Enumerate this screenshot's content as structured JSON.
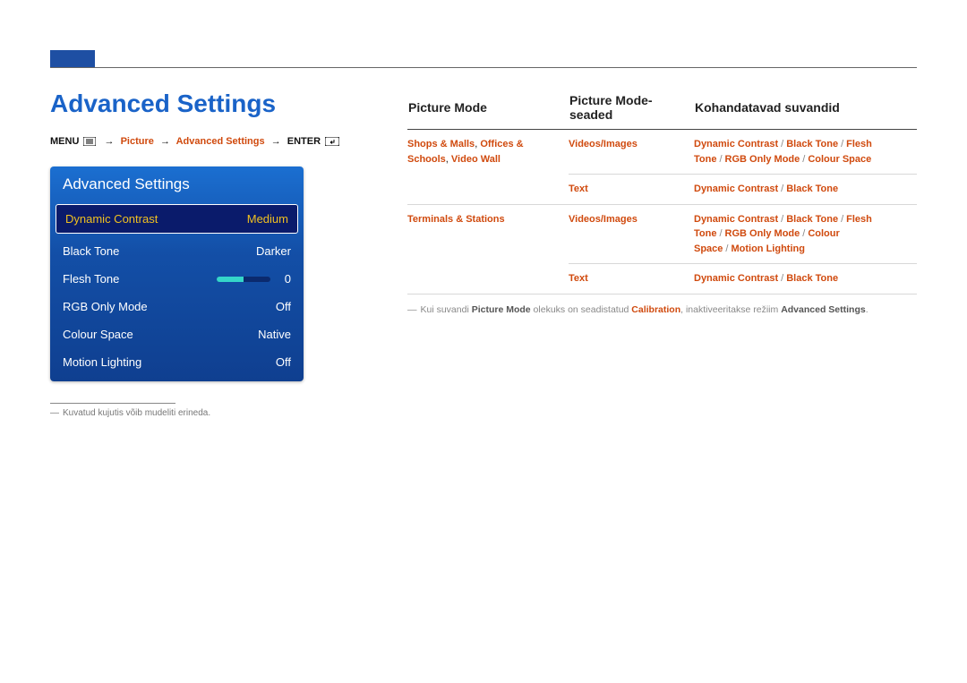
{
  "title": "Advanced Settings",
  "breadcrumb": {
    "menu": "MENU",
    "picture": "Picture",
    "adv": "Advanced Settings",
    "enter": "ENTER"
  },
  "panel": {
    "header": "Advanced Settings",
    "rows": [
      {
        "label": "Dynamic Contrast",
        "value": "Medium",
        "selected": true
      },
      {
        "label": "Black Tone",
        "value": "Darker"
      },
      {
        "label": "Flesh Tone",
        "value": "0",
        "slider": true
      },
      {
        "label": "RGB Only Mode",
        "value": "Off"
      },
      {
        "label": "Colour Space",
        "value": "Native"
      },
      {
        "label": "Motion Lighting",
        "value": "Off"
      }
    ]
  },
  "footnote": "Kuvatud kujutis võib mudeliti erineda.",
  "table": {
    "headers": [
      "Picture Mode",
      "Picture Mode-seaded",
      "Kohandatavad suvandid"
    ],
    "rows": [
      {
        "mode_parts": [
          "Shops & Malls",
          "Offices & Schools",
          "Video Wall"
        ],
        "seaded": "Videos/Images",
        "opts": [
          "Dynamic Contrast",
          "Black Tone",
          "Flesh Tone",
          "RGB Only Mode",
          "Colour Space"
        ]
      },
      {
        "seaded": "Text",
        "opts": [
          "Dynamic Contrast",
          "Black Tone"
        ]
      },
      {
        "mode_parts": [
          "Terminals & Stations"
        ],
        "seaded": "Videos/Images",
        "opts": [
          "Dynamic Contrast",
          "Black Tone",
          "Flesh Tone",
          "RGB Only Mode",
          "Colour Space",
          "Motion Lighting"
        ]
      },
      {
        "seaded": "Text",
        "opts": [
          "Dynamic Contrast",
          "Black Tone"
        ]
      }
    ]
  },
  "note2": {
    "pre": "Kui suvandi ",
    "b1": "Picture Mode",
    "mid1": " olekuks on seadistatud ",
    "o1": "Calibration",
    "mid2": ", inaktiveeritakse režiim ",
    "b2": "Advanced Settings",
    "post": "."
  }
}
